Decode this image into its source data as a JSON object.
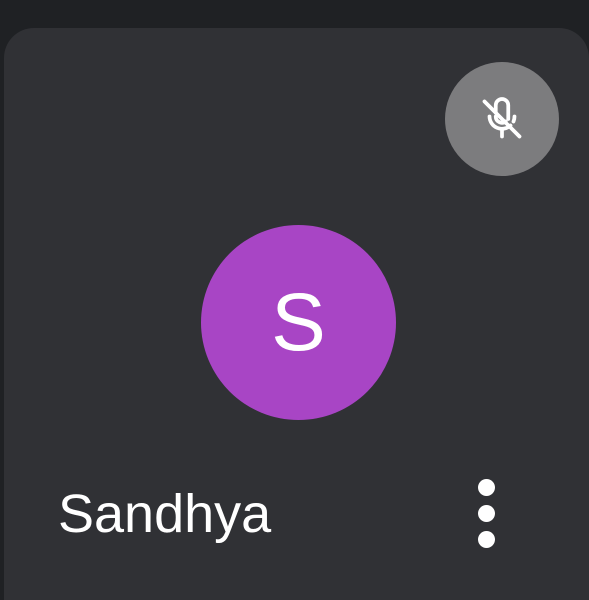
{
  "participant": {
    "name": "Sandhya",
    "initial": "S",
    "avatar_color": "#a845c5",
    "muted": true
  },
  "icons": {
    "mute": "mic-off-icon",
    "menu": "more-vert-icon"
  },
  "colors": {
    "page_background": "#1f2124",
    "tile_background": "#303135",
    "mute_badge_background": "#7c7c7e",
    "text": "#ffffff"
  }
}
